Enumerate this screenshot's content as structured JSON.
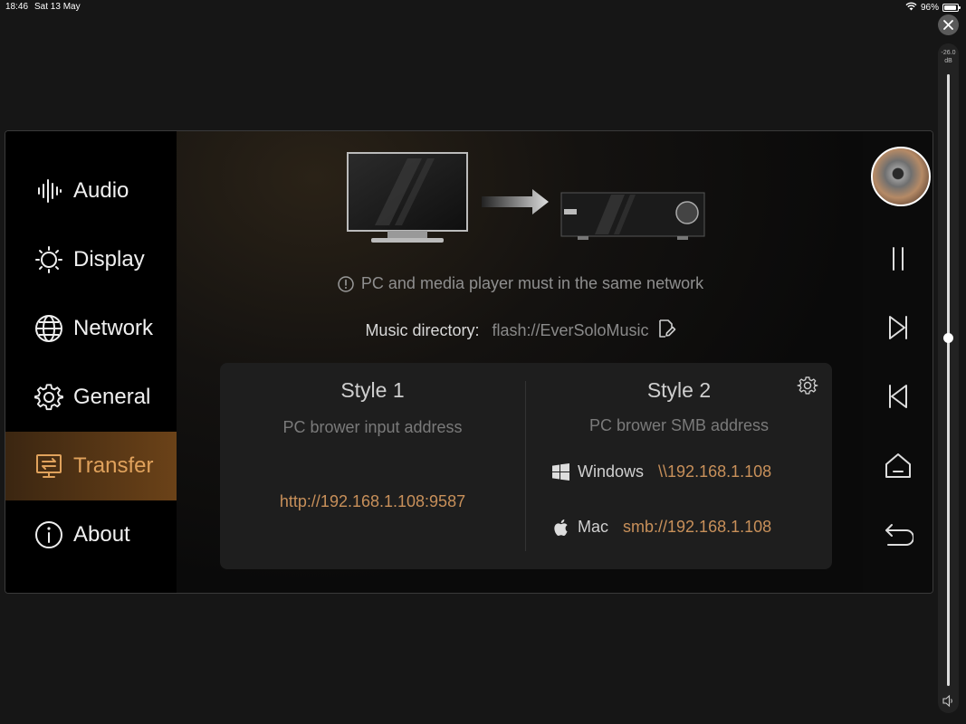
{
  "status_bar": {
    "time": "18:46",
    "date": "Sat 13 May",
    "battery": "96%",
    "battery_level": 0.96
  },
  "volume": {
    "value_label": "-26.0",
    "unit": "dB",
    "level": 0.57
  },
  "sidebar": {
    "items": [
      {
        "label": "Audio",
        "icon": "audio-bars-icon",
        "active": false
      },
      {
        "label": "Display",
        "icon": "brightness-icon",
        "active": false
      },
      {
        "label": "Network",
        "icon": "globe-icon",
        "active": false
      },
      {
        "label": "General",
        "icon": "gear-icon",
        "active": false
      },
      {
        "label": "Transfer",
        "icon": "transfer-icon",
        "active": true
      },
      {
        "label": "About",
        "icon": "info-icon",
        "active": false
      }
    ]
  },
  "transfer": {
    "notice": "PC and media player must in the same network",
    "music_dir_label": "Music directory:",
    "music_dir_value": "flash://EverSoloMusic",
    "style1": {
      "title": "Style 1",
      "subtitle": "PC brower input address",
      "address": "http://192.168.1.108:9587"
    },
    "style2": {
      "title": "Style 2",
      "subtitle": "PC brower SMB address",
      "windows_label": "Windows",
      "windows_address": "\\\\192.168.1.108",
      "mac_label": "Mac",
      "mac_address": "smb://192.168.1.108"
    }
  },
  "colors": {
    "accent": "#c8905a",
    "active_nav_text": "#e0a25c",
    "background": "#161616"
  }
}
